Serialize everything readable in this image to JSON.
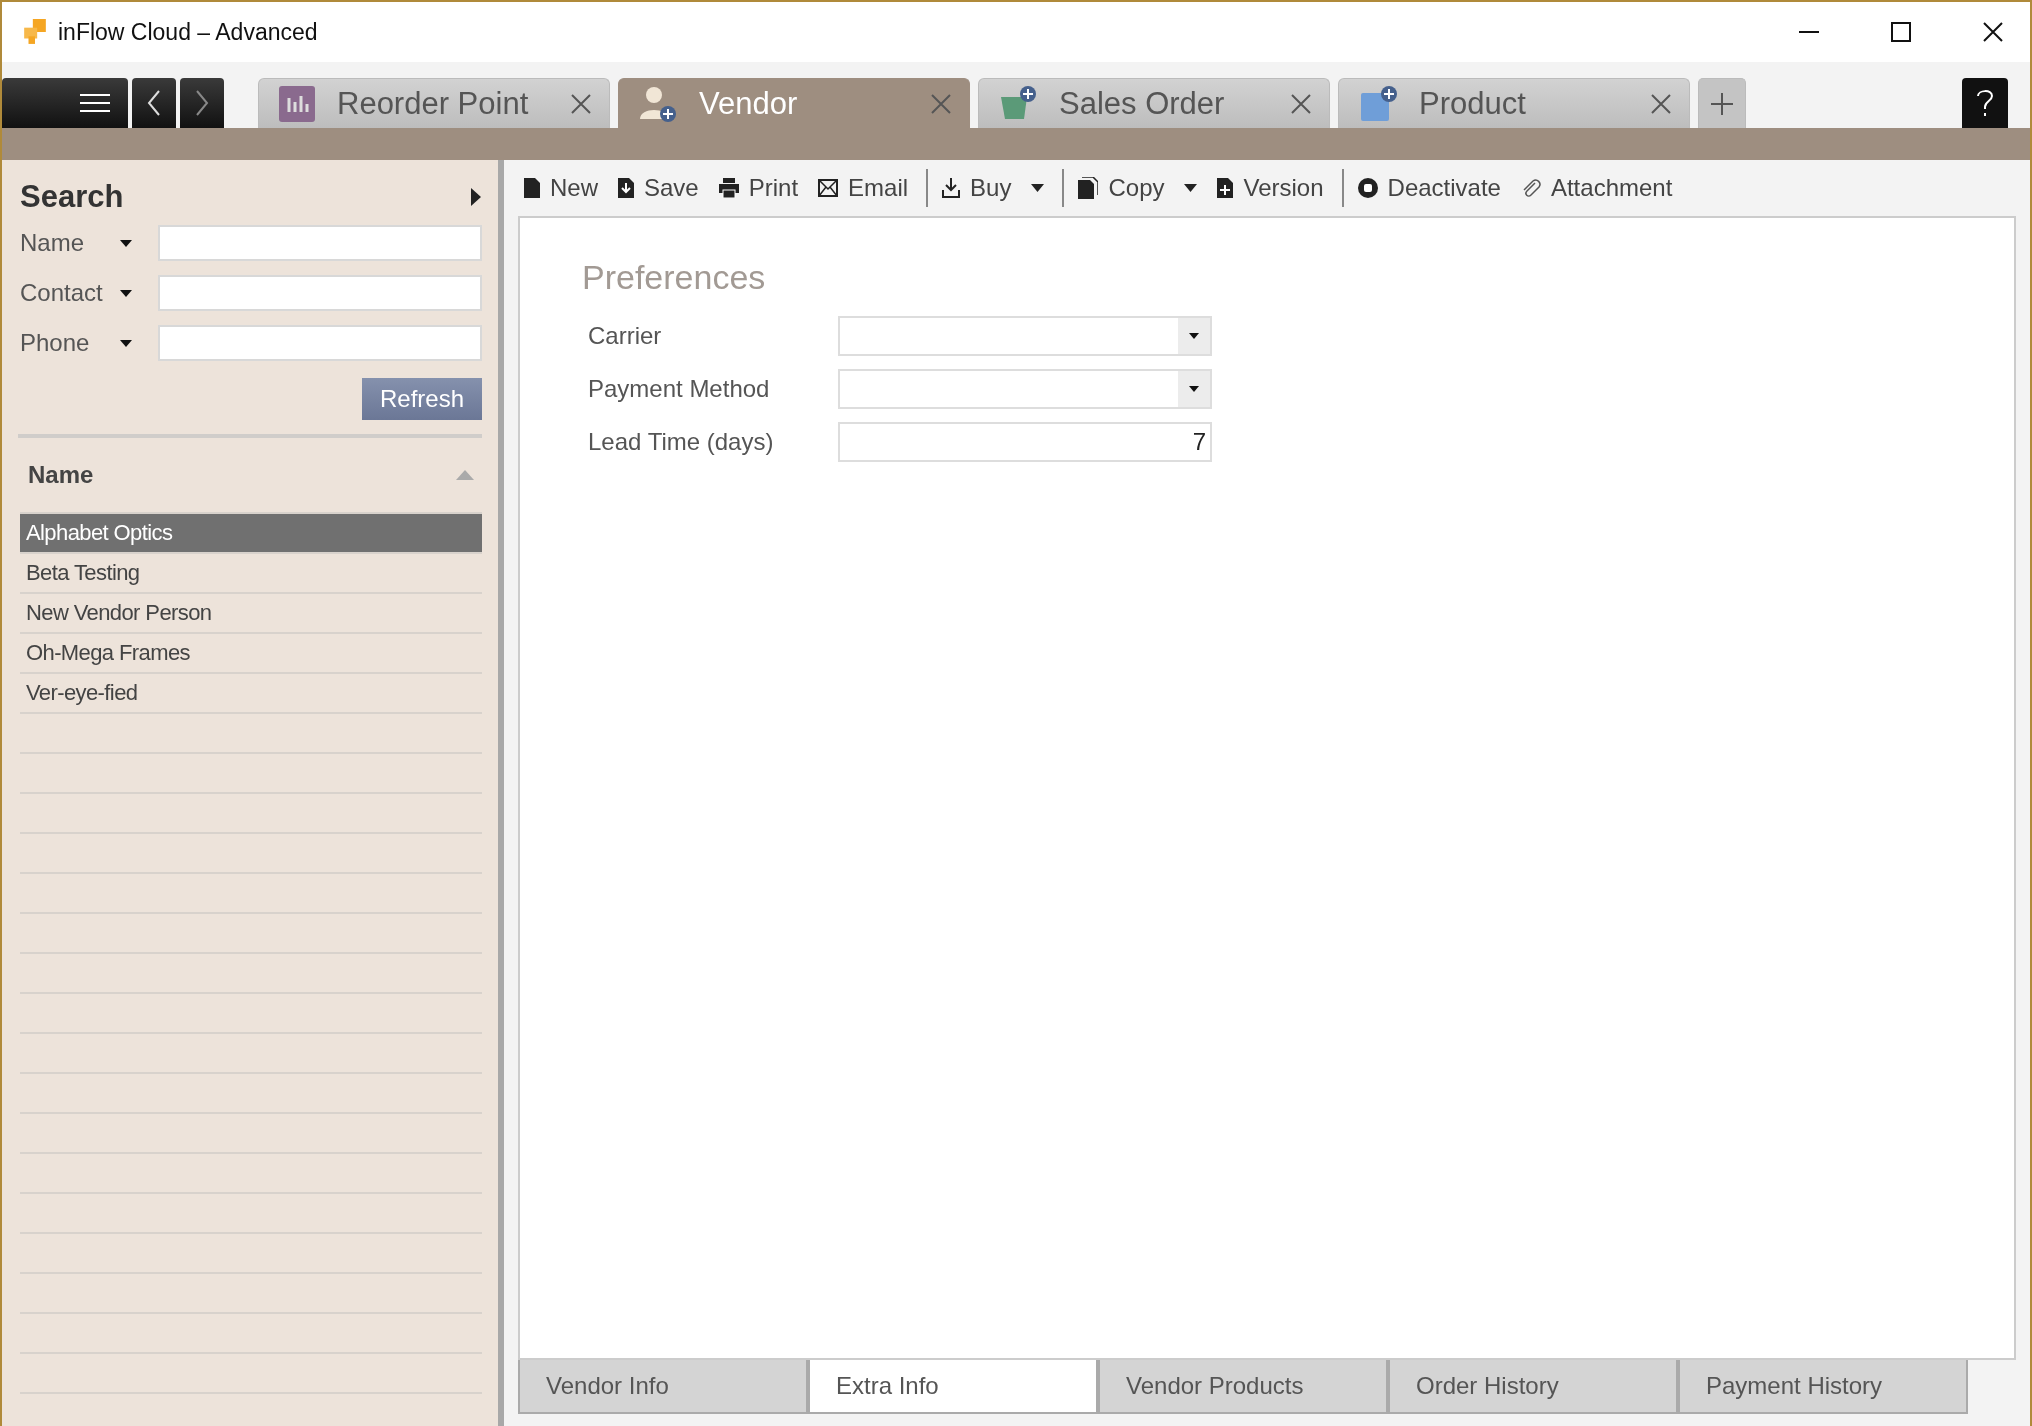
{
  "window": {
    "title": "inFlow Cloud – Advanced"
  },
  "tabs": [
    {
      "label": "Reorder Point",
      "kind": "report",
      "selected": false
    },
    {
      "label": "Vendor",
      "kind": "vendor",
      "selected": true
    },
    {
      "label": "Sales Order",
      "kind": "sales",
      "selected": false
    },
    {
      "label": "Product",
      "kind": "product",
      "selected": false
    }
  ],
  "sidebar": {
    "title": "Search",
    "filters": [
      {
        "label": "Name"
      },
      {
        "label": "Contact"
      },
      {
        "label": "Phone"
      }
    ],
    "refresh_button": "Refresh",
    "list_header": "Name",
    "items": [
      {
        "name": "Alphabet Optics",
        "selected": true
      },
      {
        "name": "Beta Testing",
        "selected": false
      },
      {
        "name": "New Vendor Person",
        "selected": false
      },
      {
        "name": "Oh-Mega Frames",
        "selected": false
      },
      {
        "name": "Ver-eye-fied",
        "selected": false
      }
    ]
  },
  "toolbar": [
    [
      {
        "label": "New",
        "kind": "new",
        "dropdown": false
      },
      {
        "label": "Save",
        "kind": "save",
        "dropdown": false
      },
      {
        "label": "Print",
        "kind": "print",
        "dropdown": false
      },
      {
        "label": "Email",
        "kind": "email",
        "dropdown": false
      }
    ],
    [
      {
        "label": "Buy",
        "kind": "buy",
        "dropdown": true
      }
    ],
    [
      {
        "label": "Copy",
        "kind": "copy",
        "dropdown": true
      },
      {
        "label": "Version",
        "kind": "version",
        "dropdown": false
      }
    ],
    [
      {
        "label": "Deactivate",
        "kind": "deactivate",
        "dropdown": false
      },
      {
        "label": "Attachment",
        "kind": "attachment",
        "dropdown": false
      }
    ]
  ],
  "form": {
    "heading": "Preferences",
    "fields": [
      {
        "label": "Carrier",
        "kind": "select"
      },
      {
        "label": "Payment Method",
        "kind": "select"
      },
      {
        "label": "Lead Time (days)",
        "kind": "number",
        "value": "7"
      }
    ]
  },
  "bottom_tabs": [
    {
      "label": "Vendor Info",
      "selected": false
    },
    {
      "label": "Extra Info",
      "selected": true
    },
    {
      "label": "Vendor Products",
      "selected": false
    },
    {
      "label": "Order History",
      "selected": false
    },
    {
      "label": "Payment History",
      "selected": false
    }
  ]
}
